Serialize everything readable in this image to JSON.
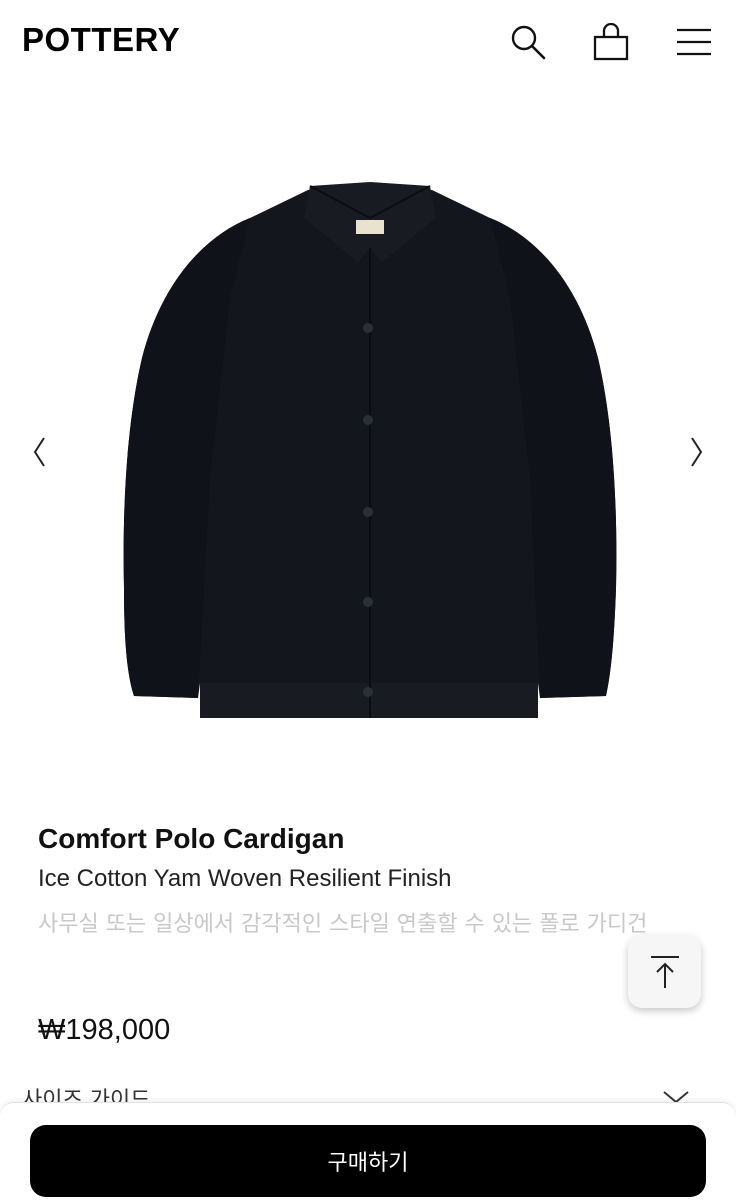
{
  "header": {
    "logo": "POTTERY",
    "icons": [
      "search-icon",
      "shopping-bag-icon",
      "hamburger-menu-icon"
    ]
  },
  "gallery": {
    "prev_glyph": "〈",
    "next_glyph": "〉",
    "image_colors": {
      "garment": "#13161d",
      "buttons": "#2b2f38"
    }
  },
  "product": {
    "title": "Comfort Polo Cardigan",
    "subtitle": "Ice Cotton Yam Woven Resilient Finish",
    "description": "사무실 또는 일상에서 감각적인 스타일 연출할 수 있는 폴로 가디건",
    "price": "₩198,000"
  },
  "size_guide": {
    "label": "사이즈 가이드"
  },
  "actions": {
    "buy_label": "구매하기"
  },
  "colors": {
    "accent": "#000000",
    "description_text": "#c8c8c8"
  }
}
